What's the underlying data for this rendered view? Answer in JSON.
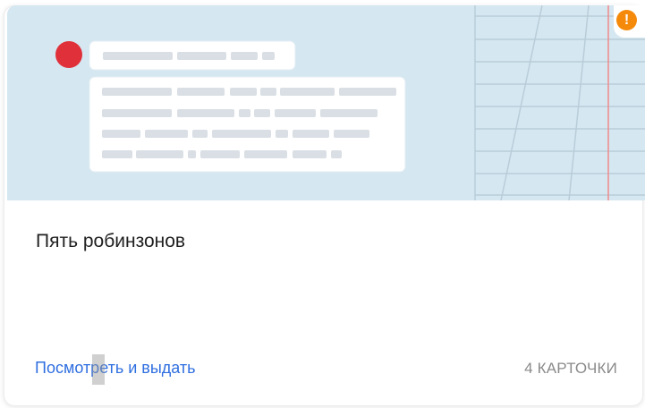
{
  "card": {
    "title": "Пять робинзонов",
    "action_label": "Посмотреть и выдать",
    "cards_count": "4 КАРТОЧКИ",
    "warning_icon": "exclamation-icon",
    "warning_symbol": "!"
  },
  "colors": {
    "illustration_bg": "#d5e7f1",
    "link": "#2f6fe0",
    "warning": "#f58a0a",
    "avatar": "#e0313a",
    "notebook_margin": "#f08a8a"
  }
}
